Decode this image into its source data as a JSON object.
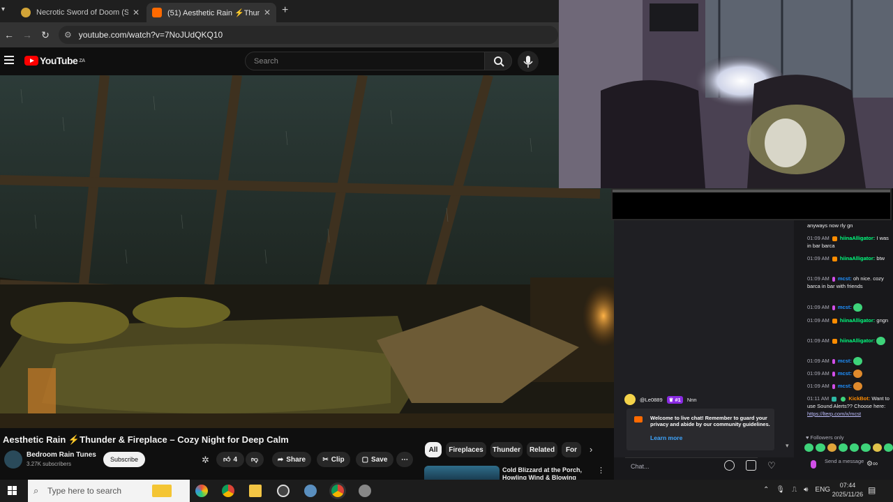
{
  "browser": {
    "tabs": [
      {
        "title": "Necrotic Sword of Doom (Swor",
        "active": false
      },
      {
        "title": "(51) Aesthetic Rain ⚡Thun",
        "active": true
      }
    ],
    "new_tab": "+",
    "url": "youtube.com/watch?v=7NoJUdQKQ10"
  },
  "youtube": {
    "logo_text": "YouTube",
    "region": "ZA",
    "search_placeholder": "Search",
    "video_title": "Aesthetic Rain ⚡Thunder & Fireplace – Cozy Night for Deep Calm",
    "channel": {
      "name": "Bedroom Rain Tunes",
      "subscribers": "3.27K subscribers"
    },
    "subscribe_label": "Subscribe",
    "like_count": "4",
    "share_label": "Share",
    "clip_label": "Clip",
    "save_label": "Save",
    "chips": [
      "All",
      "Fireplaces",
      "Thunder",
      "Related",
      "For"
    ],
    "related_video_title": "Cold Blizzard at the Porch, Howling Wind & Blowing Snow"
  },
  "chat": {
    "messages": [
      {
        "time": "",
        "user": "",
        "text": "anyways now rly gn",
        "color": "#efeff1"
      },
      {
        "time": "01:09 AM",
        "user": "hiinaAlligator:",
        "text": "I was in bar barca",
        "color": "#00ff7f"
      },
      {
        "time": "01:09 AM",
        "user": "hiinaAlligator:",
        "text": "btw",
        "color": "#00ff7f"
      },
      {
        "time": "01:09 AM",
        "user": "mcst:",
        "text": "oh nice. cozy barca in bar with friends",
        "color": "#1e90ff"
      },
      {
        "time": "01:09 AM",
        "user": "mcst:",
        "text": "",
        "color": "#1e90ff"
      },
      {
        "time": "01:09 AM",
        "user": "hiinaAlligator:",
        "text": "gngn",
        "color": "#00ff7f"
      },
      {
        "time": "01:09 AM",
        "user": "hiinaAlligator:",
        "text": "",
        "color": "#00ff7f"
      },
      {
        "time": "01:09 AM",
        "user": "mcst:",
        "text": "",
        "color": "#1e90ff"
      },
      {
        "time": "01:09 AM",
        "user": "mcst:",
        "text": "",
        "color": "#1e90ff"
      },
      {
        "time": "01:09 AM",
        "user": "mcst:",
        "text": "",
        "color": "#1e90ff"
      },
      {
        "time": "01:11 AM",
        "user": "KickBot:",
        "text": "Want to use Sound Alerts?? Choose here:",
        "color": "#ff8c00"
      }
    ],
    "link": "https://lterp.com/x/mcst",
    "pinned": {
      "user": "@Le0889",
      "rank": "#1",
      "text": "Nnn"
    },
    "yt_notice": "Welcome to live chat! Remember to guard your privacy and abide by our community guidelines.",
    "learn_more": "Learn more",
    "followers_only": "Followers only",
    "input_placeholder": "Chat...",
    "send_label": "Send a message"
  },
  "taskbar": {
    "search_placeholder": "Type here to search",
    "lang": "ENG",
    "time": "07:44",
    "date": "2025/11/26"
  }
}
